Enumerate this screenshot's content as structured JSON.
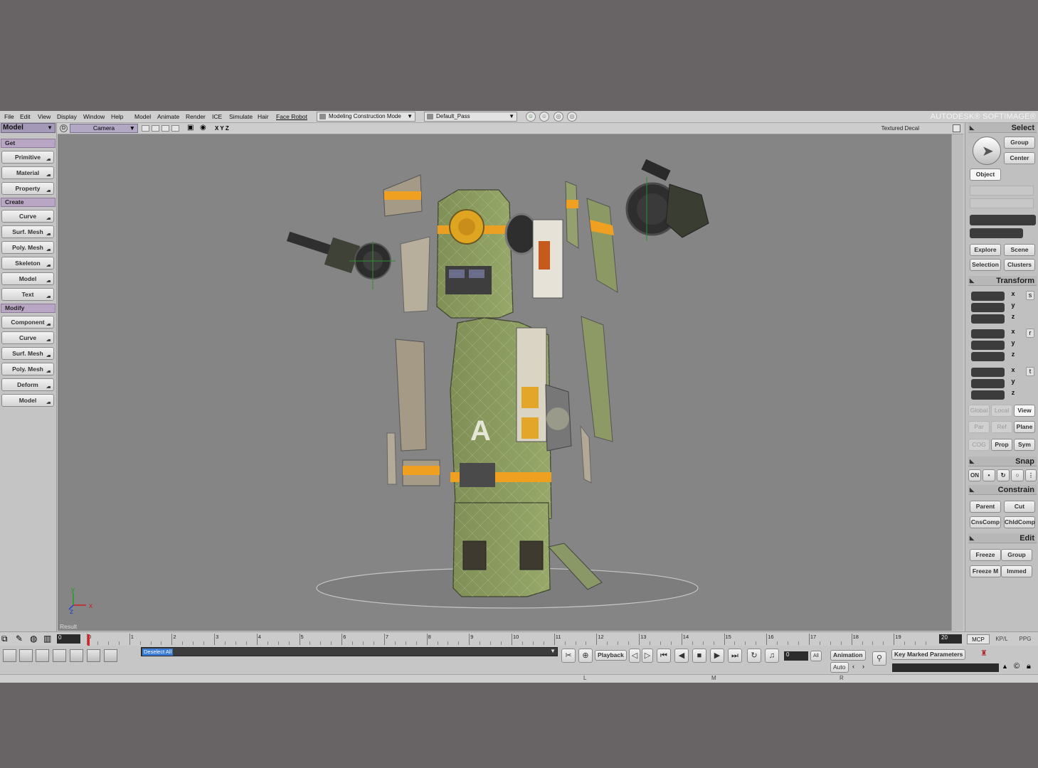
{
  "menu": {
    "items": [
      "File",
      "Edit",
      "View",
      "Display",
      "Window",
      "Help",
      "Model",
      "Animate",
      "Render",
      "ICE",
      "Simulate",
      "Hair",
      "Face Robot"
    ],
    "construction_mode": "Modeling Construction Mode",
    "render_pass": "Default_Pass"
  },
  "brand": {
    "company": "AUTODESK®",
    "product": "SOFTIMAGE®"
  },
  "left_panel": {
    "mode": "Model",
    "sections": [
      {
        "title": "Get",
        "buttons": [
          "Primitive",
          "Material",
          "Property"
        ]
      },
      {
        "title": "Create",
        "buttons": [
          "Curve",
          "Surf. Mesh",
          "Poly. Mesh",
          "Skeleton",
          "Model",
          "Text"
        ]
      },
      {
        "title": "Modify",
        "buttons": [
          "Component",
          "Curve",
          "Surf. Mesh",
          "Poly. Mesh",
          "Deform",
          "Model"
        ]
      }
    ]
  },
  "viewport": {
    "camera": "Camera",
    "axes_toggle": "X Y Z",
    "display_mode": "Textured Decal",
    "result_label": "Result",
    "axis_labels": {
      "x": "x",
      "y": "y",
      "z": "z"
    }
  },
  "right_panel": {
    "select": {
      "title": "Select",
      "group_label": "Group",
      "center_label": "Center",
      "object_label": "Object",
      "explore_label": "Explore",
      "scene_label": "Scene",
      "selection_label": "Selection",
      "clusters_label": "Clusters"
    },
    "transform": {
      "title": "Transform",
      "axes": [
        "x",
        "y",
        "z"
      ],
      "side_labels": [
        "s",
        "r",
        "t"
      ],
      "ref_modes": [
        "Global",
        "Local",
        "View"
      ],
      "ref_modes2": [
        "Par",
        "Ref",
        "Plane"
      ],
      "extra": [
        "COG",
        "Prop",
        "Sym"
      ]
    },
    "snap": {
      "title": "Snap",
      "on_label": "ON"
    },
    "constrain": {
      "title": "Constrain",
      "buttons": [
        "Parent",
        "Cut",
        "CnsComp",
        "ChldComp"
      ]
    },
    "edit": {
      "title": "Edit",
      "buttons": [
        "Freeze",
        "Group",
        "Freeze M",
        "Immed"
      ]
    }
  },
  "timeline": {
    "start_frame": "0",
    "end_frame": "20",
    "ticks": [
      "0",
      "1",
      "2",
      "3",
      "4",
      "5",
      "6",
      "7",
      "8",
      "9",
      "10",
      "11",
      "12",
      "13",
      "14",
      "15",
      "16",
      "17",
      "18",
      "19"
    ],
    "tabs": [
      "MCP",
      "KP/L",
      "PPG"
    ],
    "active_tab": "MCP"
  },
  "bottom": {
    "command": "Deselect All",
    "playback_label": "Playback",
    "current_frame": "0",
    "all_label": "All",
    "animation_label": "Animation",
    "auto_label": "Auto",
    "key_marked_label": "Key Marked Parameters"
  },
  "status_bar": {
    "l": "L",
    "m": "M",
    "r": "R"
  },
  "colors": {
    "background": "#686364",
    "viewport": "#858585",
    "mech_green": "#8a9a5e",
    "accent_orange": "#f0a020",
    "playhead": "#e02020"
  }
}
